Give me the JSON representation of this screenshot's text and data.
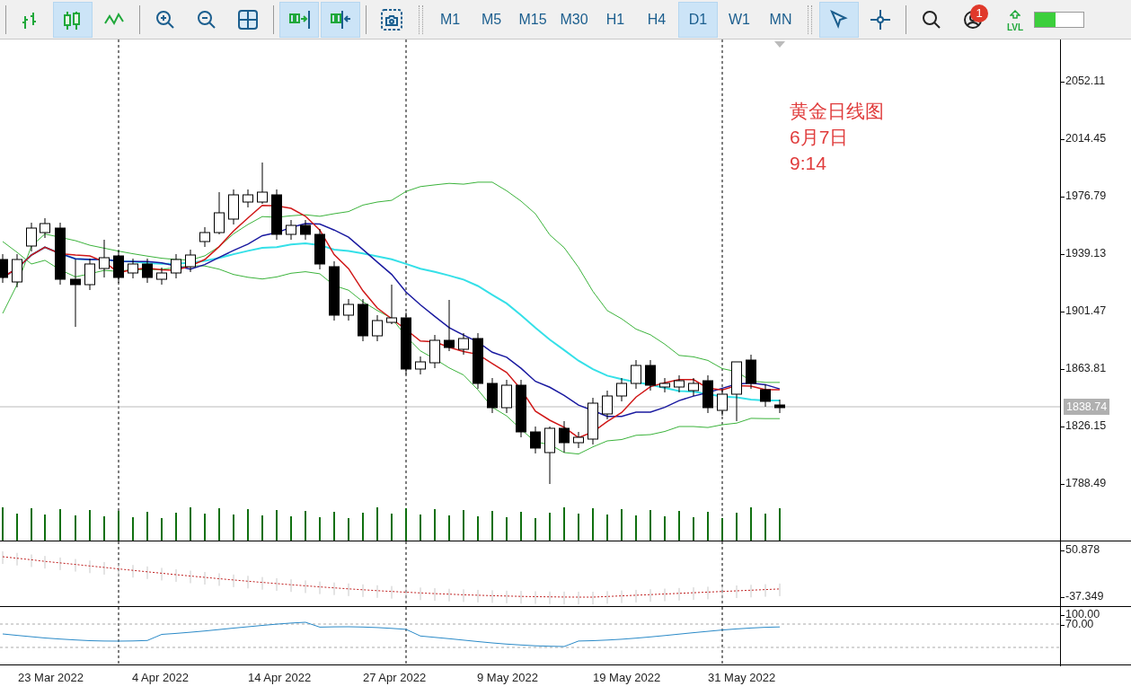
{
  "toolbar": {
    "groups": [
      {
        "items": [
          {
            "kind": "bars",
            "selected": false
          },
          {
            "kind": "candles",
            "selected": true
          },
          {
            "kind": "line",
            "selected": false
          }
        ]
      },
      {
        "items": [
          {
            "kind": "zoomin",
            "selected": false
          },
          {
            "kind": "zoomout",
            "selected": false
          },
          {
            "kind": "grid",
            "selected": false
          }
        ]
      },
      {
        "items": [
          {
            "kind": "autoscroll",
            "selected": true
          },
          {
            "kind": "shift",
            "selected": true
          }
        ]
      },
      {
        "items": [
          {
            "kind": "screenshot",
            "selected": false
          }
        ]
      }
    ],
    "timeframes": [
      {
        "label": "M1",
        "selected": false
      },
      {
        "label": "M5",
        "selected": false
      },
      {
        "label": "M15",
        "selected": false
      },
      {
        "label": "M30",
        "selected": false
      },
      {
        "label": "H1",
        "selected": false
      },
      {
        "label": "H4",
        "selected": false
      },
      {
        "label": "D1",
        "selected": true
      },
      {
        "label": "W1",
        "selected": false
      },
      {
        "label": "MN",
        "selected": false
      }
    ],
    "tools": [
      {
        "kind": "cursor",
        "selected": true
      },
      {
        "kind": "crosshair",
        "selected": false
      }
    ],
    "notifications_badge": "1",
    "level_label": "LVL",
    "meter": {
      "level": 0.42
    }
  },
  "chart": {
    "annotation": [
      "黄金日线图",
      "6月7日",
      "9:14"
    ],
    "price_axis": [
      "2052.11",
      "2014.45",
      "1976.79",
      "1939.13",
      "1901.47",
      "1863.81",
      "1826.15",
      "1788.49"
    ],
    "current_price": "1838.74",
    "oscillator_axis": [
      "50.878",
      "-37.349"
    ],
    "indicator_axis": [
      "100.00",
      "70.00"
    ],
    "dates": [
      "23 Mar 2022",
      "4 Apr 2022",
      "14 Apr 2022",
      "27 Apr 2022",
      "9 May 2022",
      "19 May 2022",
      "31 May 2022"
    ]
  }
}
